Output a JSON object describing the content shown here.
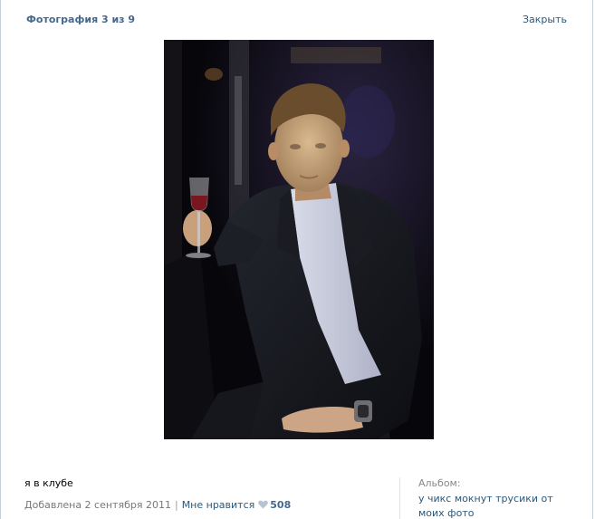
{
  "header": {
    "title": "Фотография 3 из 9",
    "close_label": "Закрыть"
  },
  "photo": {
    "alt": "я в клубе"
  },
  "caption": "я в клубе",
  "meta": {
    "added": "Добавлена 2 сентября 2011",
    "separator": "|",
    "like_label": "Мне нравится",
    "like_count": "508"
  },
  "album": {
    "label": "Альбом:",
    "name": "у чикс мокнут трусики от моих фото"
  },
  "colors": {
    "link": "#2b587a",
    "header": "#45688e",
    "muted": "#777777"
  }
}
